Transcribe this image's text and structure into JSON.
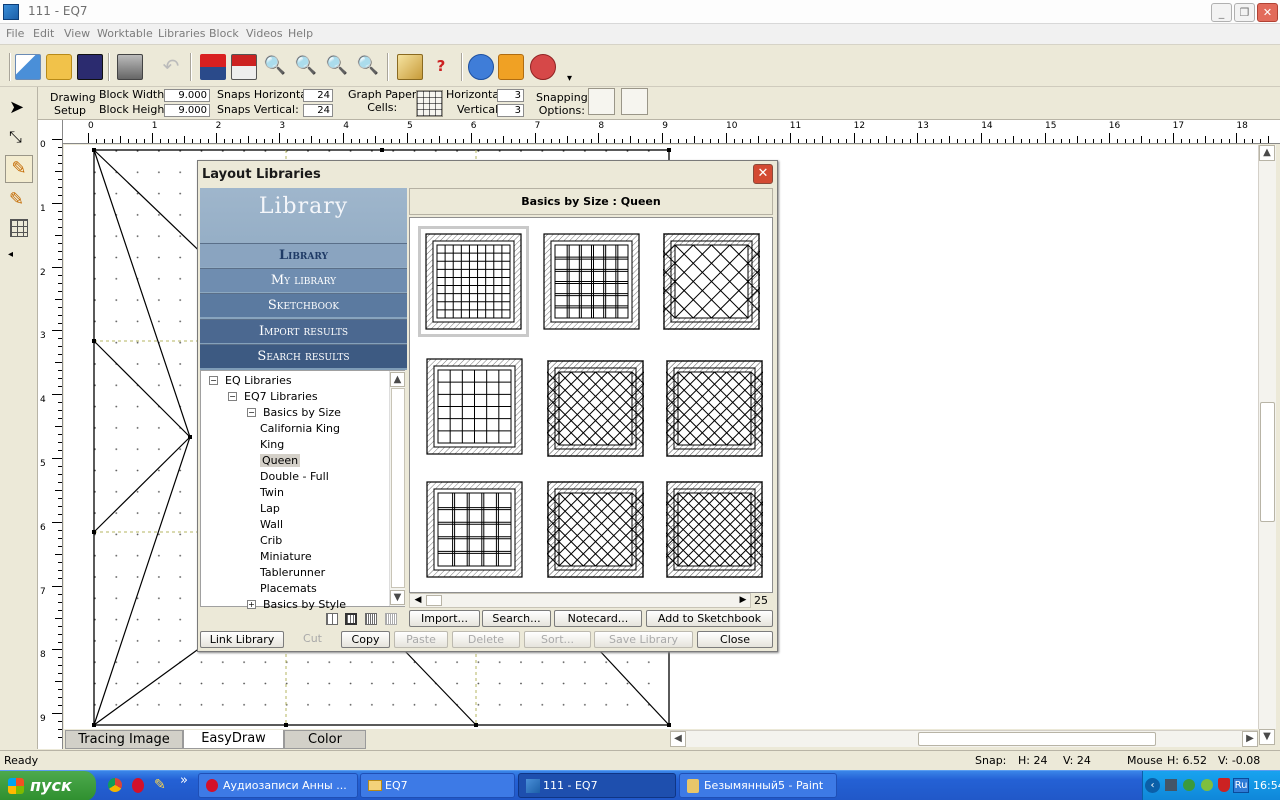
{
  "window": {
    "title": "111 - EQ7"
  },
  "menu": [
    "File",
    "Edit",
    "View",
    "Worktable",
    "Libraries",
    "Block",
    "Videos",
    "Help"
  ],
  "setup": {
    "drawing_setup": [
      "Drawing",
      "Setup"
    ],
    "block_width_label": "Block Width:",
    "block_width": "9.000",
    "block_height_label": "Block Height:",
    "block_height": "9.000",
    "snaps_h_label": "Snaps Horizontal:",
    "snaps_h": "24",
    "snaps_v_label": "Snaps Vertical:",
    "snaps_v": "24",
    "graph_paper": [
      "Graph Paper",
      "Cells:"
    ],
    "horizontal_label": "Horizontal",
    "horizontal": "3",
    "vertical_label": "Vertical",
    "vertical": "3",
    "snapping": [
      "Snapping",
      "Options:"
    ]
  },
  "ruler": {
    "h": [
      "0",
      "1",
      "2",
      "3",
      "4",
      "5",
      "6",
      "7",
      "8",
      "9",
      "10",
      "11",
      "12",
      "13",
      "14",
      "15",
      "16",
      "17",
      "18"
    ],
    "v": [
      "0",
      "1",
      "2",
      "3",
      "4",
      "5",
      "6",
      "7",
      "8",
      "9"
    ]
  },
  "dialog": {
    "title": "Layout Libraries",
    "library_logo": "Library",
    "nav": [
      "Library",
      "My library",
      "Sketchbook",
      "Import results",
      "Search results"
    ],
    "tree": [
      {
        "label": "EQ Libraries",
        "level": 0,
        "box": "−"
      },
      {
        "label": "EQ7 Libraries",
        "level": 1,
        "box": "−"
      },
      {
        "label": "Basics by Size",
        "level": 2,
        "box": "−"
      },
      {
        "label": "California King",
        "level": 3
      },
      {
        "label": "King",
        "level": 3
      },
      {
        "label": "Queen",
        "level": 3,
        "selected": true
      },
      {
        "label": "Double - Full",
        "level": 3
      },
      {
        "label": "Twin",
        "level": 3
      },
      {
        "label": "Lap",
        "level": 3
      },
      {
        "label": "Wall",
        "level": 3
      },
      {
        "label": "Crib",
        "level": 3
      },
      {
        "label": "Miniature",
        "level": 3
      },
      {
        "label": "Tablerunner",
        "level": 3
      },
      {
        "label": "Placemats",
        "level": 3
      },
      {
        "label": "Basics by Style",
        "level": 2,
        "box": "+"
      }
    ],
    "header": "Basics by Size  :  Queen",
    "page_count": "25",
    "buttons_row1": [
      "Import...",
      "Search...",
      "Notecard...",
      "Add to Sketchbook"
    ],
    "buttons_row2": [
      {
        "label": "Link Library",
        "enabled": true
      },
      {
        "label": "Cut",
        "enabled": false
      },
      {
        "label": "Copy",
        "enabled": true
      },
      {
        "label": "Paste",
        "enabled": false
      },
      {
        "label": "Delete",
        "enabled": false
      },
      {
        "label": "Sort...",
        "enabled": false
      },
      {
        "label": "Save Library",
        "enabled": false
      },
      {
        "label": "Close",
        "enabled": true
      }
    ]
  },
  "tabs": [
    "Tracing Image",
    "EasyDraw",
    "Color"
  ],
  "active_tab": "EasyDraw",
  "status": {
    "ready": "Ready",
    "snap": "Snap:",
    "snap_h": "H:  24",
    "snap_v": "V:  24",
    "mouse": "Mouse",
    "mouse_h": "H: 6.52",
    "mouse_v": "V: -0.08"
  },
  "taskbar": {
    "start": "пуск",
    "items": [
      "Аудиозаписи Анны ...",
      "EQ7",
      "111 - EQ7",
      "Безымянный5 - Paint"
    ],
    "active_item": "111 - EQ7",
    "lang": "Ru",
    "clock": "16:54"
  },
  "colors": {
    "accent_red": "#d34a33",
    "library_blue": "#7f9db8",
    "taskbar_blue": "#2461d5"
  }
}
